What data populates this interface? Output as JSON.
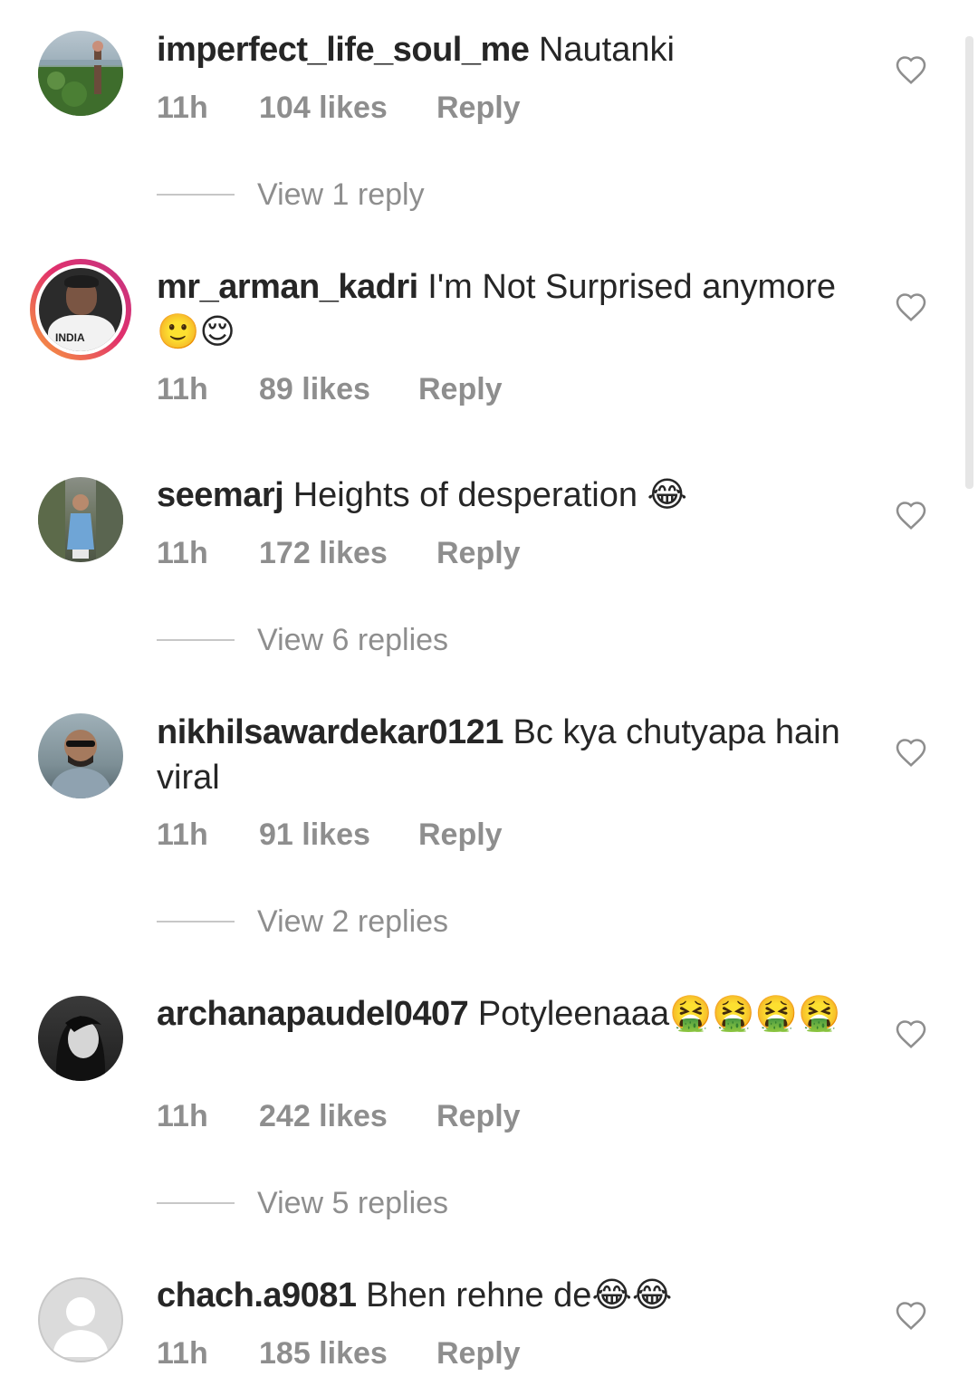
{
  "comments": [
    {
      "username": "imperfect_life_soul_me",
      "text": "Nautanki",
      "time": "11h",
      "likes": "104 likes",
      "reply": "Reply",
      "view_replies": "View 1 reply"
    },
    {
      "username": "mr_arman_kadri",
      "text": "I'm Not Surprised anymore 🙂😌",
      "time": "11h",
      "likes": "89 likes",
      "reply": "Reply",
      "avatar_text": "INDIA"
    },
    {
      "username": "seemarj",
      "text": "Heights of desperation 😂",
      "time": "11h",
      "likes": "172 likes",
      "reply": "Reply",
      "view_replies": "View 6 replies"
    },
    {
      "username": "nikhilsawardekar0121",
      "text": "Bc kya chutyapa hain viral",
      "time": "11h",
      "likes": "91 likes",
      "reply": "Reply",
      "view_replies": "View 2 replies"
    },
    {
      "username": "archanapaudel0407",
      "text": "Potyleenaaa🤮🤮🤮🤮",
      "time": "11h",
      "likes": "242 likes",
      "reply": "Reply",
      "view_replies": "View 5 replies"
    },
    {
      "username": "chach.a9081",
      "text": "Bhen rehne de😂😂",
      "time": "11h",
      "likes": "185 likes",
      "reply": "Reply"
    }
  ],
  "icons": {
    "like": "heart-outline-icon",
    "avatar_placeholder": "person-icon"
  },
  "colors": {
    "text": "#262626",
    "secondary": "#8e8e8e",
    "story_ring_start": "#f9a33b",
    "story_ring_end": "#c13584"
  }
}
